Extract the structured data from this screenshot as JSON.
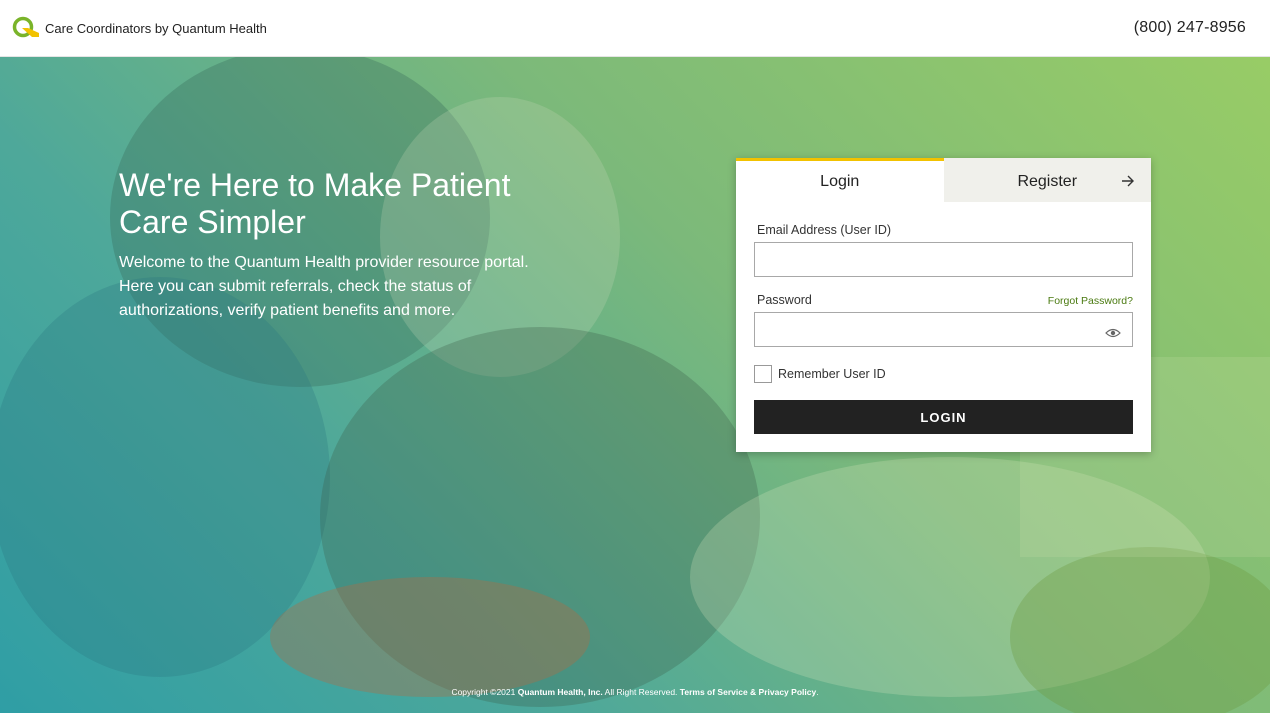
{
  "header": {
    "brand_name": "Care Coordinators by Quantum Health",
    "phone": "(800) 247-8956"
  },
  "hero": {
    "headline": "We're Here to Make Patient Care Simpler",
    "subtext": "Welcome to the Quantum Health provider resource portal. Here you can submit referrals, check the status of authorizations, verify patient benefits and more."
  },
  "login_card": {
    "tabs": [
      {
        "label": "Login",
        "active": true
      },
      {
        "label": "Register",
        "active": false
      }
    ],
    "email_label": "Email Address (User ID)",
    "email_value": "",
    "password_label": "Password",
    "password_value": "",
    "forgot_password": "Forgot Password?",
    "remember_label": "Remember User ID",
    "remember_checked": false,
    "login_button": "LOGIN"
  },
  "footer": {
    "copyright": "Copyright ©2021",
    "company": "Quantum Health, Inc.",
    "rights": "All Right Reserved.",
    "terms": "Terms of Service & Privacy Policy",
    "end": "."
  },
  "icons": {
    "logo": "quantum-health-logo",
    "register_arrow": "arrow-right-icon",
    "password_toggle": "eye-icon"
  },
  "colors": {
    "accent_yellow": "#f2c200",
    "link_green": "#4a7a10",
    "button_dark": "#222222",
    "hero_teal": "#2f9ea5",
    "hero_green": "#98cc66"
  }
}
